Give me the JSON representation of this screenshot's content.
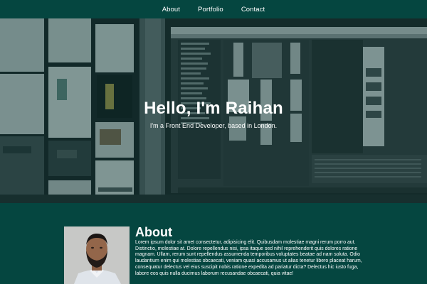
{
  "nav": {
    "items": [
      {
        "label": "About"
      },
      {
        "label": "Portfolio"
      },
      {
        "label": "Contact"
      }
    ]
  },
  "hero": {
    "title": "Hello, I'm Raihan",
    "subtitle": "I'm a Front End Developer, based in London."
  },
  "about": {
    "title": "About",
    "text": "Lorem ipsum dolor sit amet consectetur, adipisicing elit. Quibusdam molestiae magni rerum porro aut. Distinctio, molestiae at. Dolore repellendus nisi, ipsa itaque sed nihil reprehenderit quis dolores ratione magnam. Ullam, rerum sunt repellendus assumenda temporibus voluptates beatae ad nam soluta. Odio laudantium enim qui molestias obcaecati, veniam quasi accusamus ut alias tenetur libero placeat harum, consequatur delectus vel eius suscipit nobis ratione expedita ad pariatur dicta? Delectus hic iusto fuga, labore eos quis nulla ducimus laborum recusandae obcaecati, quia vitae!"
  },
  "colors": {
    "background": "#054640",
    "text": "#ffffff"
  }
}
